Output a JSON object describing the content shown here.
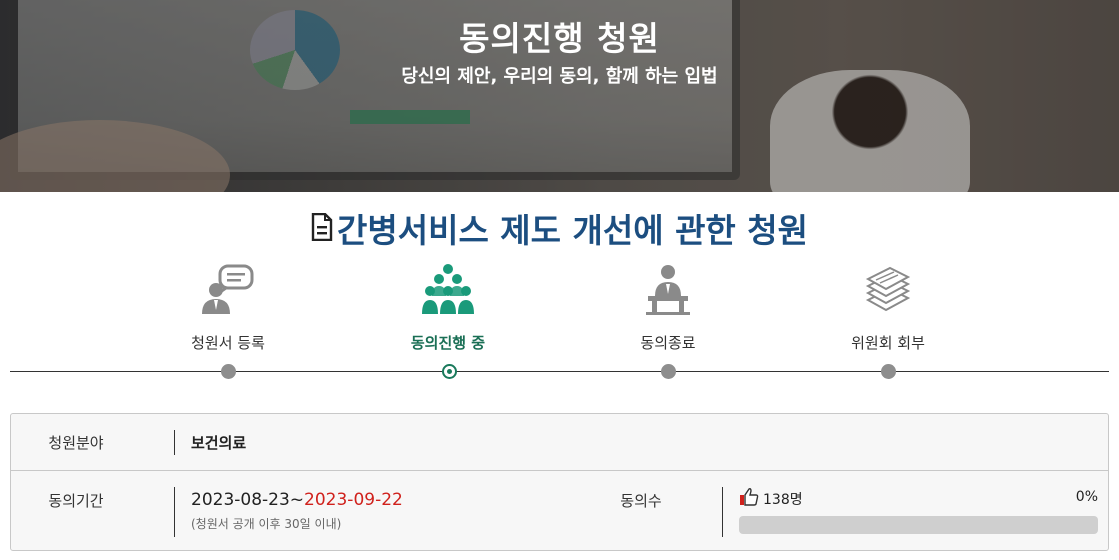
{
  "hero": {
    "title": "동의진행 청원",
    "subtitle": "당신의 제안, 우리의 동의, 함께 하는 입법"
  },
  "petition": {
    "title": "간병서비스 제도 개선에 관한 청원"
  },
  "steps": [
    {
      "label": "청원서 등록",
      "icon": "speaker-person-icon",
      "active": false
    },
    {
      "label": "동의진행 중",
      "icon": "group-people-icon",
      "active": true
    },
    {
      "label": "동의종료",
      "icon": "podium-person-icon",
      "active": false
    },
    {
      "label": "위원회 회부",
      "icon": "document-stack-icon",
      "active": false
    }
  ],
  "info": {
    "field_label": "청원분야",
    "field_value": "보건의료",
    "period_label": "동의기간",
    "period_start": "2023-08-23~",
    "period_end": "2023-09-22",
    "period_note": "(청원서 공개 이후 30일 이내)",
    "count_label": "동의수",
    "count_value": "138명",
    "percent_text": "0%",
    "progress_fraction": 0.0
  },
  "colors": {
    "title_blue": "#1c4e80",
    "active_green": "#1a7a5c",
    "end_date_red": "#d0211c",
    "inactive_gray": "#8e8e8e"
  }
}
